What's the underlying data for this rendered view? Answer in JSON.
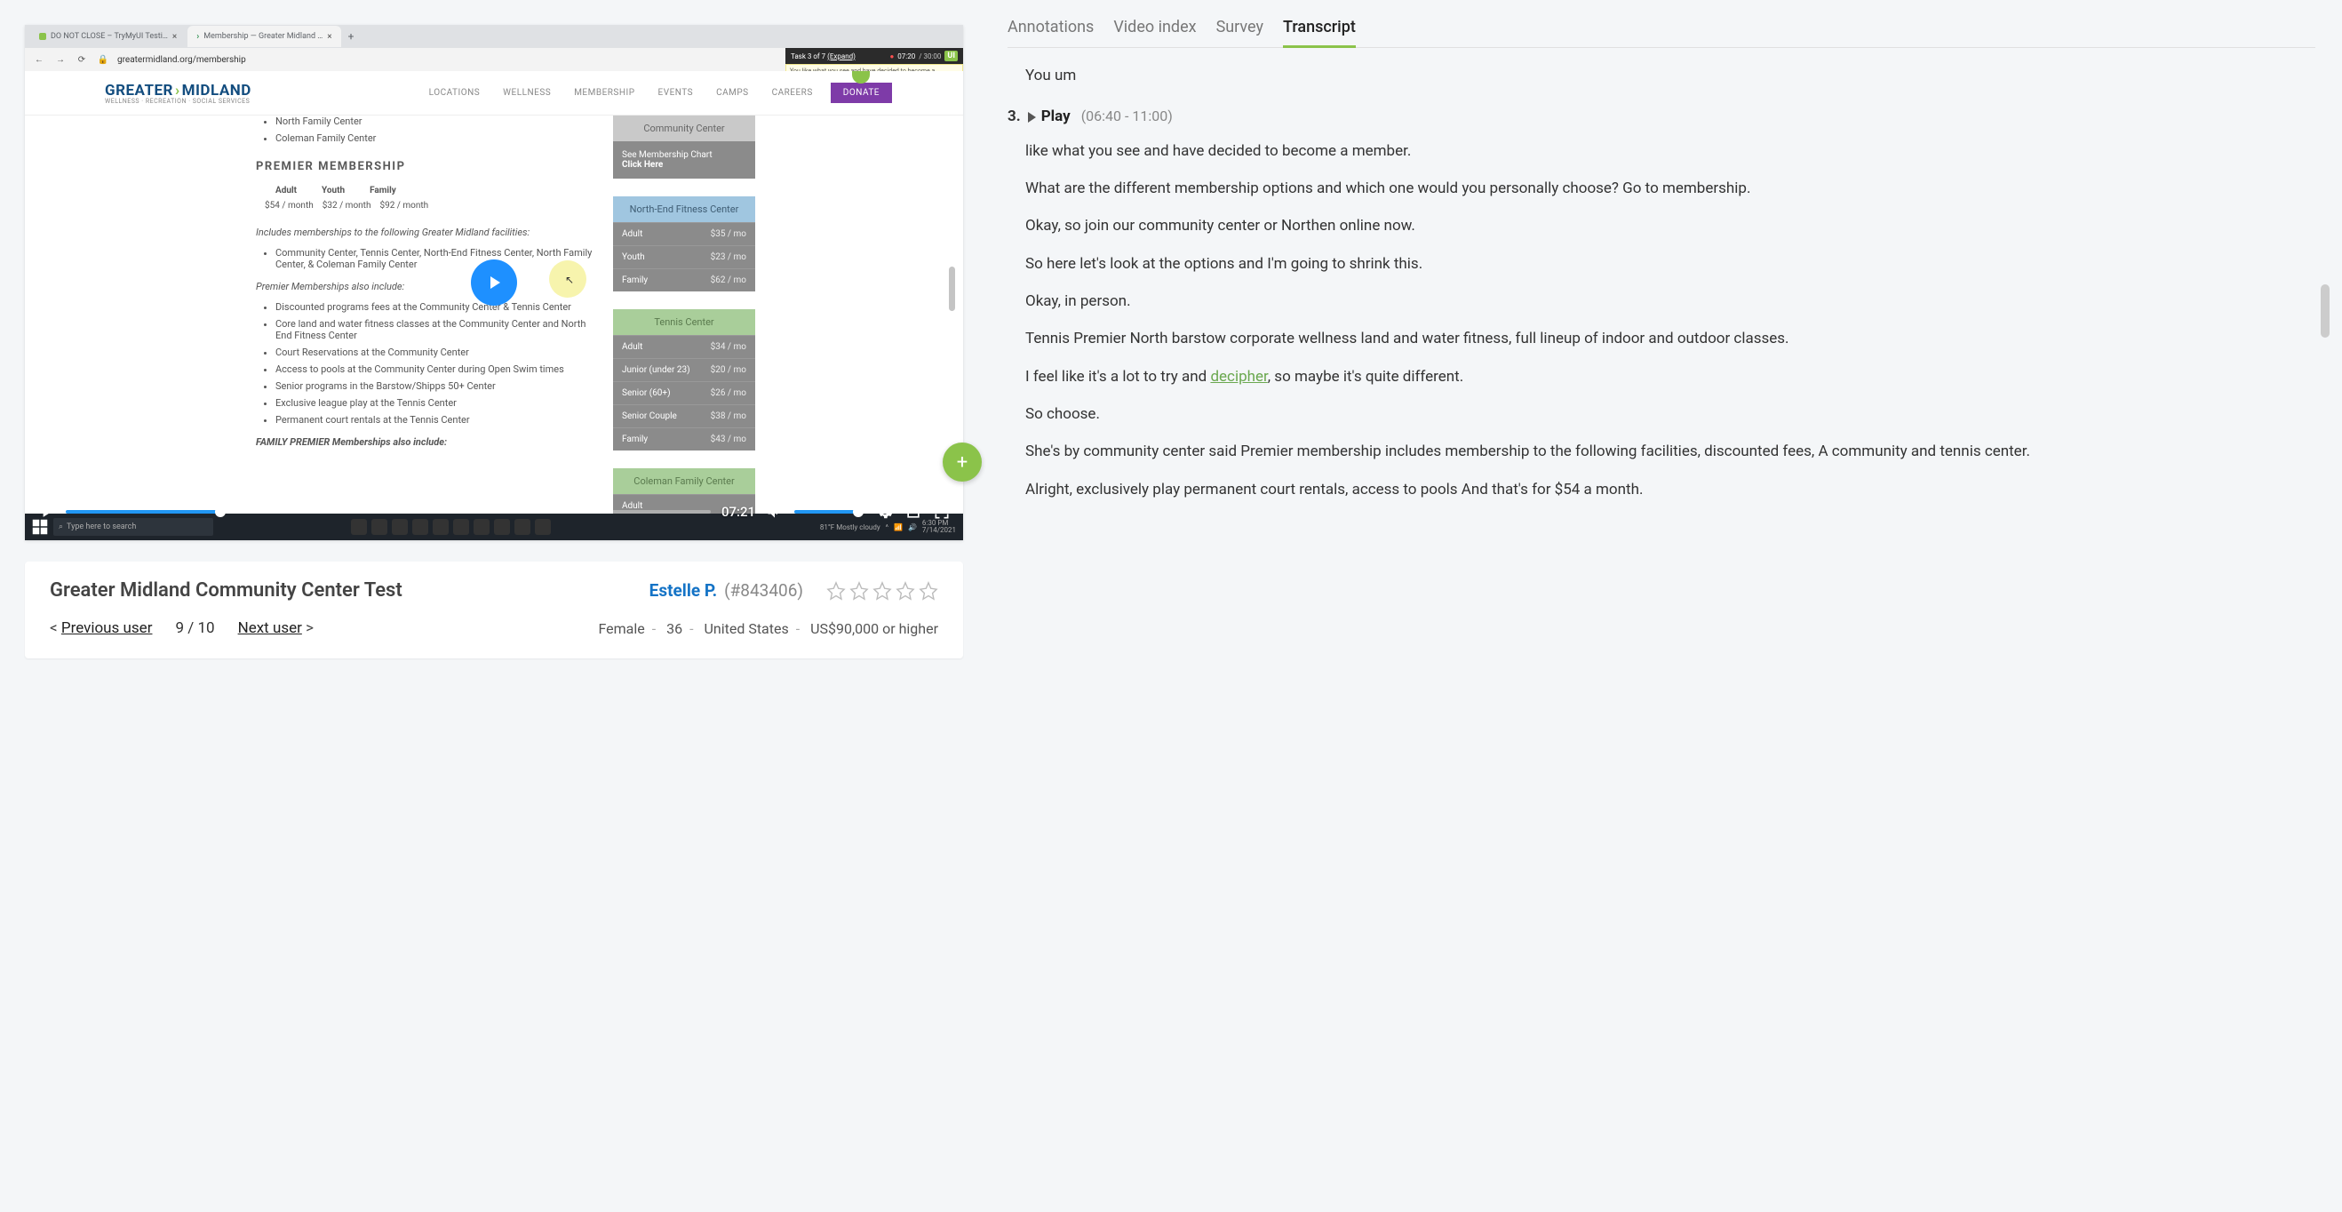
{
  "browser": {
    "tabs": [
      {
        "title": "DO NOT CLOSE – TryMyUI Testi…"
      },
      {
        "title": "Membership — Greater Midland …"
      }
    ],
    "url": "greatermidland.org/membership"
  },
  "task_overlay": {
    "task": "Task 3 of 7",
    "expand": "(Expand)",
    "time": "07:20",
    "total": "/ 30:00",
    "badge": "UI",
    "detail": "You like what you see and have decided to become a member. What are the different membership options, and which one do you think you would personal…"
  },
  "site": {
    "logo_a": "GREATER",
    "logo_b": "MIDLAND",
    "logo_sub": "WELLNESS · RECREATION · SOCIAL SERVICES",
    "nav": [
      "LOCATIONS",
      "WELLNESS",
      "MEMBERSHIP",
      "EVENTS",
      "CAMPS",
      "CAREERS"
    ],
    "donate": "DONATE",
    "facilities_top": [
      "North Family Center",
      "Coleman Family Center"
    ],
    "premier_heading": "PREMIER MEMBERSHIP",
    "price_headers": [
      "Adult",
      "Youth",
      "Family"
    ],
    "prices": [
      "$54 / month",
      "$32 / month",
      "$92 / month"
    ],
    "includes_lead": "Includes memberships to the following Greater Midland facilities:",
    "includes_item": "Community Center, Tennis Center, North-End Fitness Center, North Family Center, & Coleman Family Center",
    "also_lead": "Premier Memberships also include:",
    "also_items": [
      "Discounted programs fees at the Community Center & Tennis Center",
      "Core land and water fitness classes at the Community Center and North End Fitness Center",
      "Court Reservations at the Community Center",
      "Access to pools at the Community Center during Open Swim times",
      "Senior programs in the Barstow/Shipps 50+ Center",
      "Exclusive league play at the Tennis Center",
      "Permanent court rentals at the Tennis Center"
    ],
    "family_lead": "FAMILY PREMIER Memberships also include:"
  },
  "cards": {
    "community": {
      "title": "Community Center",
      "link1": "See Membership Chart",
      "link2": "Click Here"
    },
    "north": {
      "title": "North-End Fitness Center",
      "rows": [
        {
          "label": "Adult",
          "price": "$35 / mo"
        },
        {
          "label": "Youth",
          "price": "$23 / mo"
        },
        {
          "label": "Family",
          "price": "$62 / mo"
        }
      ]
    },
    "tennis": {
      "title": "Tennis Center",
      "rows": [
        {
          "label": "Adult",
          "price": "$34 / mo"
        },
        {
          "label": "Junior (under 23)",
          "price": "$20 / mo"
        },
        {
          "label": "Senior (60+)",
          "price": "$26 / mo"
        },
        {
          "label": "Senior Couple",
          "price": "$38 / mo"
        },
        {
          "label": "Family",
          "price": "$43 / mo"
        }
      ]
    },
    "coleman": {
      "title": "Coleman Family Center",
      "rows": [
        {
          "label": "Adult",
          "price": ""
        }
      ]
    }
  },
  "player": {
    "time": "07:21"
  },
  "taskbar": {
    "search": "Type here to search",
    "weather": "81°F  Mostly cloudy",
    "clock": "6:30 PM",
    "date": "7/14/2021"
  },
  "info": {
    "test_name": "Greater Midland Community Center Test",
    "tester_name": "Estelle P.",
    "tester_id": "(#843406)",
    "prev_caret": "<",
    "prev": "Previous user",
    "counter": "9 / 10",
    "next": "Next user",
    "next_caret": ">",
    "demo": {
      "gender": "Female",
      "age": "36",
      "country": "United States",
      "income": "US$90,000 or higher"
    }
  },
  "tabs_right": [
    "Annotations",
    "Video index",
    "Survey",
    "Transcript"
  ],
  "transcript": {
    "pre": "You um",
    "seg_num": "3.",
    "seg_label": "Play",
    "seg_time": "(06:40 - 11:00)",
    "paras": [
      "like what you see and have decided to become a member.",
      "What are the different membership options and which one would you personally choose? Go to membership.",
      "Okay, so join our community center or Northen online now.",
      "So here let's look at the options and I'm going to shrink this.",
      "Okay, in person.",
      "Tennis Premier North barstow corporate wellness land and water fitness, full lineup of indoor and outdoor classes."
    ],
    "decipher_pre": "I feel like it's a lot to try and ",
    "decipher_link": "decipher",
    "decipher_post": ", so maybe it's quite different.",
    "paras2": [
      "So choose.",
      "She's by community center said Premier membership includes membership to the following facilities, discounted fees, A community and tennis center.",
      "Alright, exclusively play permanent court rentals, access to pools And that's for $54 a month."
    ]
  }
}
